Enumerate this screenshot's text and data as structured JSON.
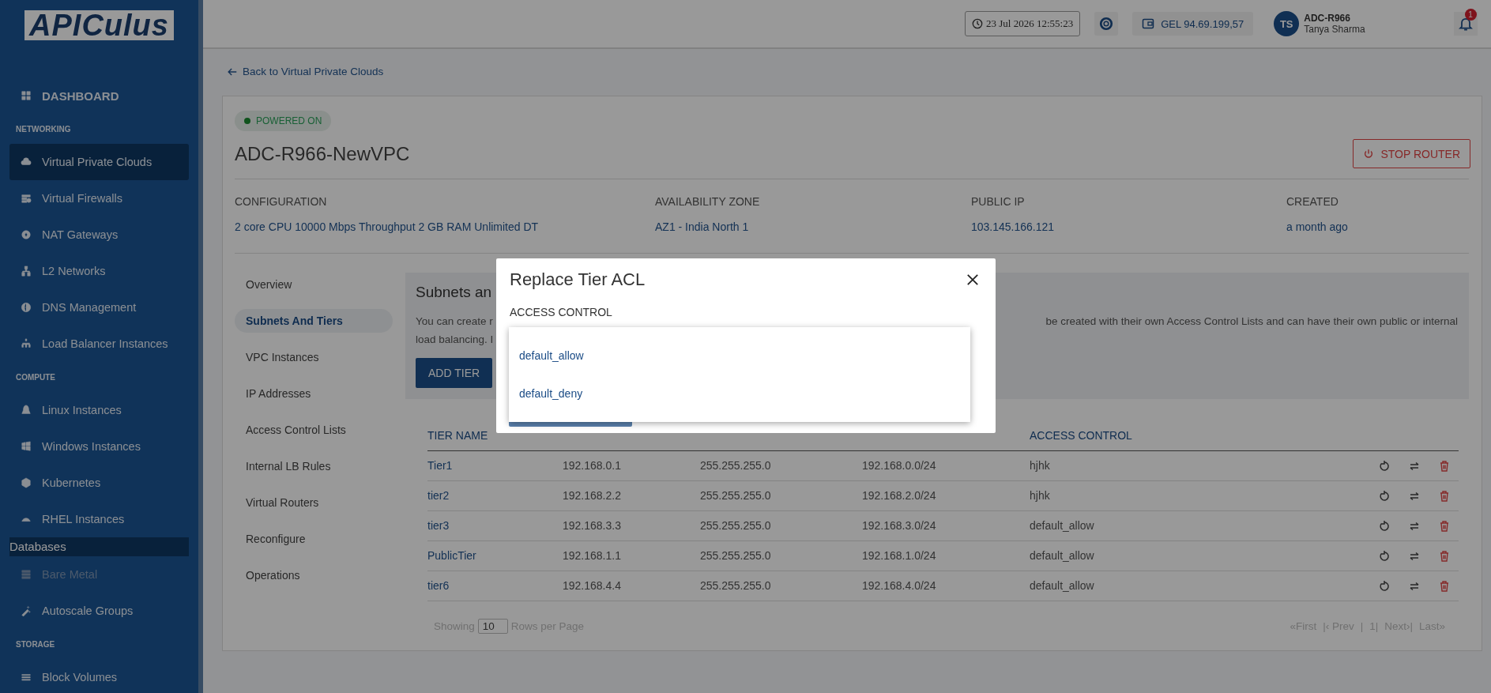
{
  "sidebar": {
    "logo": "APICulus",
    "items": [
      {
        "kind": "top",
        "label": "DASHBOARD",
        "selected": false,
        "disabled": false
      },
      {
        "kind": "heading",
        "label": "NETWORKING"
      },
      {
        "kind": "link",
        "label": "Virtual Private Clouds",
        "selected": true,
        "disabled": false
      },
      {
        "kind": "link",
        "label": "Virtual Firewalls",
        "selected": false,
        "disabled": false
      },
      {
        "kind": "link",
        "label": "NAT Gateways",
        "selected": false,
        "disabled": false
      },
      {
        "kind": "link",
        "label": "L2 Networks",
        "selected": false,
        "disabled": false
      },
      {
        "kind": "link",
        "label": "DNS Management",
        "selected": false,
        "disabled": false
      },
      {
        "kind": "link",
        "label": "Load Balancer Instances",
        "selected": false,
        "disabled": false
      },
      {
        "kind": "heading",
        "label": "COMPUTE"
      },
      {
        "kind": "link",
        "label": "Linux Instances",
        "selected": false,
        "disabled": false
      },
      {
        "kind": "link",
        "label": "Windows Instances",
        "selected": false,
        "disabled": false
      },
      {
        "kind": "link",
        "label": "Kubernetes",
        "selected": false,
        "disabled": false
      },
      {
        "kind": "link",
        "label": "RHEL Instances",
        "selected": false,
        "disabled": false
      },
      {
        "kind": "group",
        "label": "Databases",
        "selected": true,
        "disabled": false
      },
      {
        "kind": "link",
        "label": "Bare Metal",
        "selected": false,
        "disabled": true
      },
      {
        "kind": "link",
        "label": "Autoscale Groups",
        "selected": false,
        "disabled": false
      },
      {
        "kind": "heading",
        "label": "STORAGE"
      },
      {
        "kind": "link",
        "label": "Block Volumes",
        "selected": false,
        "disabled": false
      }
    ]
  },
  "topbar": {
    "datetime": "23 Jul 2026 12:55:23",
    "balance": "GEL 94.69.199,57",
    "avatar": "TS",
    "account": "ADC-R966",
    "user": "Tanya Sharma",
    "notifications": "1"
  },
  "back_link": "Back to Virtual Private Clouds",
  "vpc": {
    "status": "POWERED ON",
    "powered_on": true,
    "name": "ADC-R966-NewVPC",
    "stop_button": "STOP ROUTER",
    "details": [
      {
        "label": "CONFIGURATION",
        "value": "2 core CPU 10000 Mbps Throughput 2 GB RAM Unlimited DT"
      },
      {
        "label": "AVAILABILITY ZONE",
        "value": "AZ1 - India North 1"
      },
      {
        "label": "PUBLIC IP",
        "value": "103.145.166.121"
      },
      {
        "label": "CREATED",
        "value": "a month ago"
      }
    ]
  },
  "tabs": [
    {
      "label": "Overview",
      "selected": false
    },
    {
      "label": "Subnets And Tiers",
      "selected": true
    },
    {
      "label": "VPC Instances",
      "selected": false
    },
    {
      "label": "IP Addresses",
      "selected": false
    },
    {
      "label": "Access Control Lists",
      "selected": false
    },
    {
      "label": "Internal LB Rules",
      "selected": false
    },
    {
      "label": "Virtual Routers",
      "selected": false
    },
    {
      "label": "Reconfigure",
      "selected": false
    },
    {
      "label": "Operations",
      "selected": false
    }
  ],
  "panel": {
    "title": "Subnets an",
    "text_left": [
      "You can create r",
      "load balancing. I"
    ],
    "text_right": [
      "be created with their own Access Control Lists and can have their own public or internal"
    ],
    "add_button": "ADD TIER"
  },
  "table": {
    "columns": {
      "column_1": "TIER NAME",
      "column_5": "ACCESS CONTROL"
    },
    "rows": [
      [
        "Tier1",
        "192.168.0.1",
        "255.255.255.0",
        "192.168.0.0/24",
        "hjhk"
      ],
      [
        "tier2",
        "192.168.2.2",
        "255.255.255.0",
        "192.168.2.0/24",
        "hjhk"
      ],
      [
        "tier3",
        "192.168.3.3",
        "255.255.255.0",
        "192.168.3.0/24",
        "default_allow"
      ],
      [
        "PublicTier",
        "192.168.1.1",
        "255.255.255.0",
        "192.168.1.0/24",
        "default_allow"
      ],
      [
        "tier6",
        "192.168.4.4",
        "255.255.255.0",
        "192.168.4.0/24",
        "default_allow"
      ]
    ]
  },
  "pagination": {
    "showing": "Showing",
    "page_size": "10",
    "rows_per_page": "Rows per Page",
    "links": [
      "«First",
      "|‹ Prev",
      "|",
      "1|",
      "Next›|",
      "Last»"
    ]
  },
  "modal": {
    "title": "Replace Tier ACL",
    "label": "ACCESS CONTROL",
    "options": [
      "default_allow",
      "default_deny"
    ]
  }
}
